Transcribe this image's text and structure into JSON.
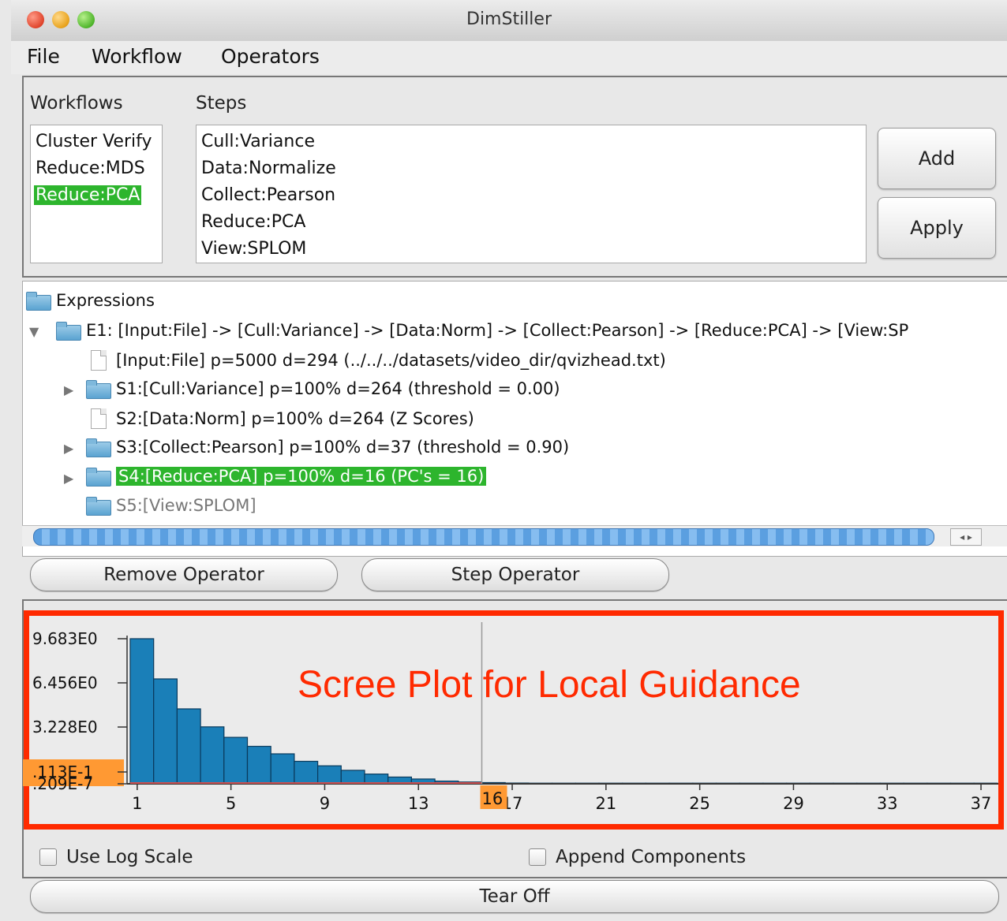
{
  "window": {
    "title": "DimStiller"
  },
  "menu": [
    "File",
    "Workflow",
    "Operators"
  ],
  "workflows": {
    "label": "Workflows",
    "items": [
      {
        "label": "Cluster Verify",
        "selected": false
      },
      {
        "label": "Reduce:MDS",
        "selected": false
      },
      {
        "label": "Reduce:PCA",
        "selected": true
      }
    ]
  },
  "steps": {
    "label": "Steps",
    "items": [
      "Cull:Variance",
      "Data:Normalize",
      "Collect:Pearson",
      "Reduce:PCA",
      "View:SPLOM"
    ]
  },
  "buttons": {
    "add": "Add",
    "apply": "Apply",
    "remove_operator": "Remove Operator",
    "step_operator": "Step Operator",
    "tear_off": "Tear Off"
  },
  "tree": {
    "root": "Expressions",
    "e1": "E1: [Input:File] -> [Cull:Variance] -> [Data:Norm] -> [Collect:Pearson] -> [Reduce:PCA] -> [View:SP",
    "children": [
      {
        "text": "[Input:File] p=5000 d=294 (../../../datasets/video_dir/qvizhead.txt)",
        "icon": "file-icon",
        "expandable": false,
        "selected": false,
        "dimmed": false
      },
      {
        "text": "S1:[Cull:Variance] p=100% d=264 (threshold = 0.00)",
        "icon": "folder-icon",
        "expandable": true,
        "selected": false,
        "dimmed": false
      },
      {
        "text": "S2:[Data:Norm] p=100% d=264 (Z Scores)",
        "icon": "file-icon",
        "expandable": false,
        "selected": false,
        "dimmed": false
      },
      {
        "text": "S3:[Collect:Pearson] p=100% d=37 (threshold = 0.90)",
        "icon": "folder-icon",
        "expandable": true,
        "selected": false,
        "dimmed": false
      },
      {
        "text": "S4:[Reduce:PCA] p=100% d=16 (PC's = 16)",
        "icon": "folder-icon",
        "expandable": true,
        "selected": true,
        "dimmed": false
      },
      {
        "text": "S5:[View:SPLOM]",
        "icon": "folder-icon",
        "expandable": false,
        "selected": false,
        "dimmed": true
      }
    ]
  },
  "annotation": "Scree Plot for Local Guidance",
  "chart_data": {
    "type": "bar",
    "y_tick_labels": [
      "9.683E0",
      "6.456E0",
      "3.228E0",
      ".113E-1",
      ".209E-7"
    ],
    "highlight_y_label": ".113E-1",
    "x_tick_labels": [
      "1",
      "5",
      "9",
      "13",
      "17",
      "21",
      "25",
      "29",
      "33",
      "37"
    ],
    "x_ticks": [
      1,
      5,
      9,
      13,
      17,
      21,
      25,
      29,
      33,
      37
    ],
    "cutoff_component": 16,
    "cutoff_label": "16",
    "x": [
      1,
      2,
      3,
      4,
      5,
      6,
      7,
      8,
      9,
      10,
      11,
      12,
      13,
      14,
      15,
      16,
      17,
      18,
      19,
      20,
      21,
      22,
      23,
      24,
      25,
      26,
      27,
      28,
      29,
      30,
      31,
      32,
      33,
      34,
      35,
      36,
      37
    ],
    "values": [
      9.683,
      7.0,
      5.0,
      3.8,
      3.1,
      2.5,
      2.0,
      1.5,
      1.2,
      0.9,
      0.65,
      0.45,
      0.32,
      0.18,
      0.12,
      0.08,
      0.05,
      0.04,
      0.03,
      0.025,
      0.02,
      0.015,
      0.012,
      0.01,
      0.008,
      0.006,
      0.005,
      0.004,
      0.003,
      0.002,
      0.002,
      0.001,
      0.001,
      0.001,
      0.0005,
      0.0003,
      0.0001
    ],
    "ylim": [
      0,
      9.683
    ],
    "bar_color": "#1a7fb8",
    "cutoff_color": "#ff9933"
  },
  "options": {
    "log_scale": "Use Log Scale",
    "append_components": "Append Components"
  }
}
